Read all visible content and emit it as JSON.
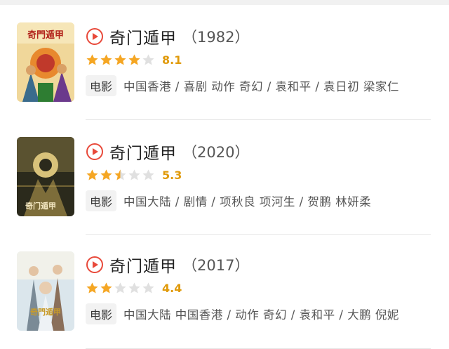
{
  "movies": [
    {
      "title": "奇门遁甲",
      "year": "（1982）",
      "rating": 8.1,
      "score_text": "8.1",
      "stars": [
        "full",
        "full",
        "full",
        "full",
        "empty"
      ],
      "type_tag": "电影",
      "meta": "中国香港 / 喜剧 动作 奇幻 / 袁和平 / 袁日初 梁家仁",
      "poster_title": "奇門遁甲"
    },
    {
      "title": "奇门遁甲",
      "year": "（2020）",
      "rating": 5.3,
      "score_text": "5.3",
      "stars": [
        "full",
        "full",
        "half",
        "empty",
        "empty"
      ],
      "type_tag": "电影",
      "meta": "中国大陆 / 剧情 / 项秋良 项河生 / 贺鹏 林妍柔",
      "poster_title": "奇门遁甲"
    },
    {
      "title": "奇门遁甲",
      "year": "（2017）",
      "rating": 4.4,
      "score_text": "4.4",
      "stars": [
        "full",
        "full",
        "empty",
        "empty",
        "empty"
      ],
      "type_tag": "电影",
      "meta": "中国大陆 中国香港 / 动作 奇幻 / 袁和平 / 大鹏 倪妮",
      "poster_title": "奇門遁甲"
    }
  ],
  "colors": {
    "play_icon": "#e8493a",
    "star_full": "#f5a623",
    "star_empty": "#e0e0e0",
    "score": "#e09a0b"
  }
}
